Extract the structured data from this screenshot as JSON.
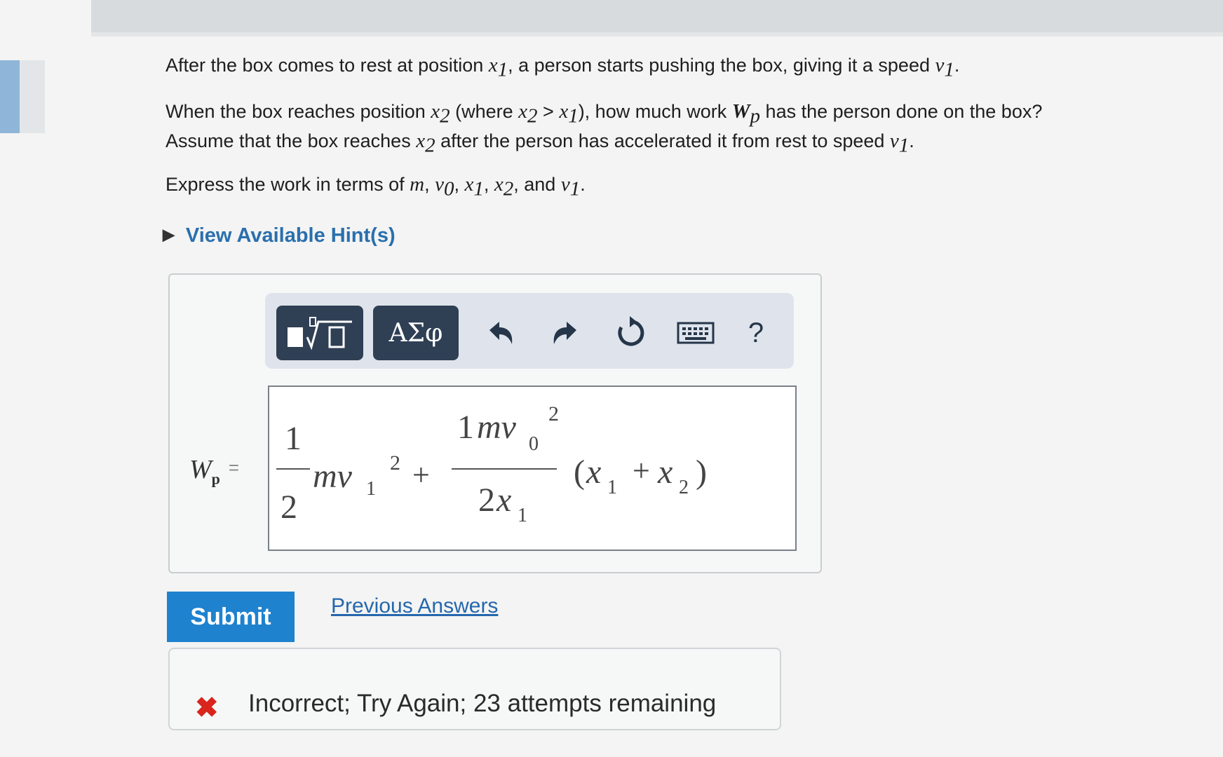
{
  "question": {
    "p1_prefix": "After the box comes to rest at position ",
    "p1_var1": "x",
    "p1_sub1": "1",
    "p1_mid": ", a person starts pushing the box, giving it a speed ",
    "p1_var2": "v",
    "p1_sub2": "1",
    "p1_end": ".",
    "p2_a": "When the box reaches position ",
    "p2_b": " (where ",
    "p2_c": " > ",
    "p2_d": "), how much work ",
    "p2_e": " has the person done on the box?",
    "p3_a": "Assume that the box reaches ",
    "p3_b": " after the person has accelerated it from rest to speed ",
    "p3_end": ".",
    "p4_a": "Express the work in terms of ",
    "p4_and": ", and ",
    "p4_end": ".",
    "sym_x": "x",
    "sym_v": "v",
    "sym_m": "m",
    "sym_W": "W",
    "sub_0": "0",
    "sub_1": "1",
    "sub_2": "2",
    "sub_p": "p",
    "comma": ", "
  },
  "hint_link": "View Available Hint(s)",
  "toolbar": {
    "templates_label": "▮√□",
    "greek_label": "ΑΣφ",
    "undo_icon": "undo-icon",
    "redo_icon": "redo-icon",
    "reset_icon": "reset-icon",
    "keyboard_icon": "keyboard-icon",
    "help_label": "?"
  },
  "answer": {
    "label_var": "W",
    "label_sub": "p",
    "label_eq": "=",
    "frac1_num": "1",
    "frac1_den": "2",
    "term1_var": "mv",
    "term1_sub": "1",
    "term1_exp": "2",
    "plus1": "+",
    "frac2_num_coef": "1",
    "frac2_num_var": "mv",
    "frac2_num_sub": "0",
    "frac2_num_exp": "2",
    "frac2_den_coef": "2",
    "frac2_den_var": "x",
    "frac2_den_sub": "1",
    "paren_open": "(",
    "paren_x": "x",
    "paren_sub1": "1",
    "paren_plus": "+",
    "paren_x2": "x",
    "paren_sub2": "2",
    "paren_close": ")"
  },
  "submit_label": "Submit",
  "previous_answers_label": "Previous Answers",
  "feedback": {
    "icon": "x-mark-icon",
    "text": "Incorrect; Try Again; 23 attempts remaining",
    "color": "#d9251c"
  }
}
